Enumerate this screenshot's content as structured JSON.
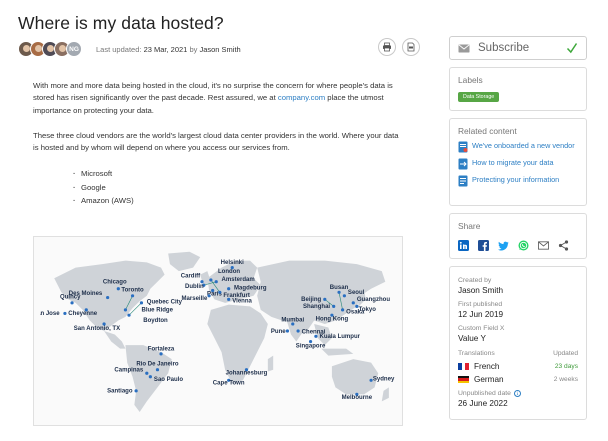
{
  "article": {
    "title": "Where is my data hosted?",
    "author_badge": "NG",
    "updated_prefix": "Last updated:",
    "updated_date": "23 Mar, 2021",
    "by_word": "by",
    "author": "Jason Smith",
    "p1_text": "With more and more data being hosted in the cloud, it's no surprise the concern for where people's data is stored has risen significantly over the past decade. Rest assured, we at ",
    "p1_link": "company.com",
    "p1_tail": " place the utmost importance on protecting your data.",
    "p2_text": "These three cloud vendors are the world's largest cloud data center providers in the world. Where your data is hosted and by whom will depend on where you access our services from.",
    "vendors": [
      "Microsoft",
      "Google",
      "Amazon (AWS)"
    ]
  },
  "map": {
    "land_color": "#cfd3d8",
    "ocean_color": "#fafafa",
    "marker_color": "#2a6fc1",
    "line_color": "#2c8a7a",
    "cities": [
      {
        "name": "Chicago"
      },
      {
        "name": "Toronto"
      },
      {
        "name": "Quebec City"
      },
      {
        "name": "Des Moines"
      },
      {
        "name": "Quincy"
      },
      {
        "name": "San Jose"
      },
      {
        "name": "Cheyenne"
      },
      {
        "name": "Blue Ridge"
      },
      {
        "name": "Boydton"
      },
      {
        "name": "San Antonio, TX"
      },
      {
        "name": "Fortaleza"
      },
      {
        "name": "Rio De Janeiro"
      },
      {
        "name": "Campinas"
      },
      {
        "name": "Sao Paulo"
      },
      {
        "name": "Santiago"
      },
      {
        "name": "Dublin"
      },
      {
        "name": "London"
      },
      {
        "name": "Helsinki"
      },
      {
        "name": "Cardiff"
      },
      {
        "name": "Amsterdam"
      },
      {
        "name": "Magdeburg"
      },
      {
        "name": "Paris"
      },
      {
        "name": "Marseille"
      },
      {
        "name": "Frankfurt"
      },
      {
        "name": "Vienna"
      },
      {
        "name": "Cape Town"
      },
      {
        "name": "Johannesburg"
      },
      {
        "name": "Busan"
      },
      {
        "name": "Seoul"
      },
      {
        "name": "Beijing"
      },
      {
        "name": "Guangzhou"
      },
      {
        "name": "Tokyo"
      },
      {
        "name": "Shanghai"
      },
      {
        "name": "Osaka"
      },
      {
        "name": "Hong Kong"
      },
      {
        "name": "Mumbai"
      },
      {
        "name": "Pune"
      },
      {
        "name": "Chennai"
      },
      {
        "name": "Kuala Lumpur"
      },
      {
        "name": "Singapore"
      },
      {
        "name": "Sydney"
      },
      {
        "name": "Melbourne"
      }
    ]
  },
  "sidebar": {
    "subscribe_label": "Subscribe",
    "labels_title": "Labels",
    "tag": "Data Storage",
    "related_title": "Related content",
    "related": [
      "We've onboarded a new vendor",
      "How to migrate your data",
      "Protecting your information"
    ],
    "share_title": "Share",
    "share_colors": {
      "linkedin": "#0a66c2",
      "facebook": "#1f4e96",
      "twitter": "#1da1f2",
      "whatsapp": "#25d366"
    },
    "created_by_label": "Created by",
    "created_by": "Jason Smith",
    "first_published_label": "First published",
    "first_published": "12 Jun 2019",
    "custom_field_label": "Custom Field X",
    "custom_field": "Value Y",
    "translations_label": "Translations",
    "translations_updated_label": "Updated",
    "translations": [
      {
        "lang": "French",
        "updated": "23 days"
      },
      {
        "lang": "German",
        "updated": "2 weeks"
      }
    ],
    "unpublished_label": "Unpublished date",
    "unpublished": "26 June 2022"
  }
}
